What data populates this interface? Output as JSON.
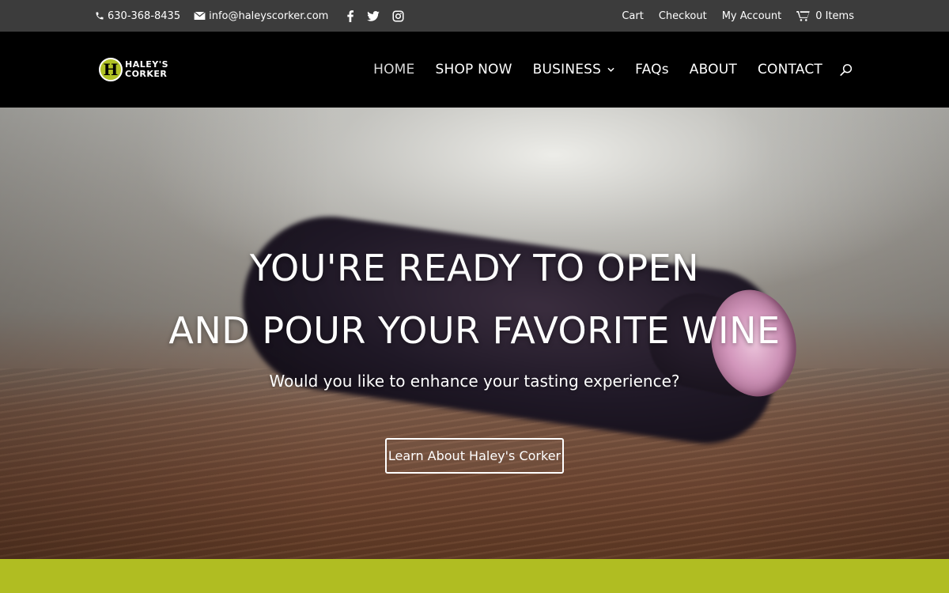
{
  "topbar": {
    "phone": "630-368-8435",
    "email": "info@haleyscorker.com",
    "social": [
      "facebook-icon",
      "twitter-icon",
      "instagram-icon"
    ],
    "links": [
      "Cart",
      "Checkout",
      "My Account"
    ],
    "cart_count": "0 Items",
    "bg_color": "#3c3c3c"
  },
  "header": {
    "logo": {
      "mark_letter": "H",
      "line1": "HALEY'S",
      "line2": "CORKER"
    },
    "nav": [
      {
        "label": "HOME",
        "active": true
      },
      {
        "label": "SHOP NOW"
      },
      {
        "label": "BUSINESS",
        "dropdown_icon": "3"
      },
      {
        "label": "FAQs"
      },
      {
        "label": "ABOUT"
      },
      {
        "label": "CONTACT"
      }
    ],
    "search_icon": "search-icon"
  },
  "hero": {
    "headline_line1": "YOU'RE READY TO OPEN",
    "headline_line2": "AND POUR YOUR FAVORITE WINE",
    "subheadline": "Would you like to enhance your tasting experience?",
    "cta_label": "Learn About Haley's Corker"
  },
  "colors": {
    "brand_green": "#b0bd22",
    "header_bg": "#000000"
  }
}
